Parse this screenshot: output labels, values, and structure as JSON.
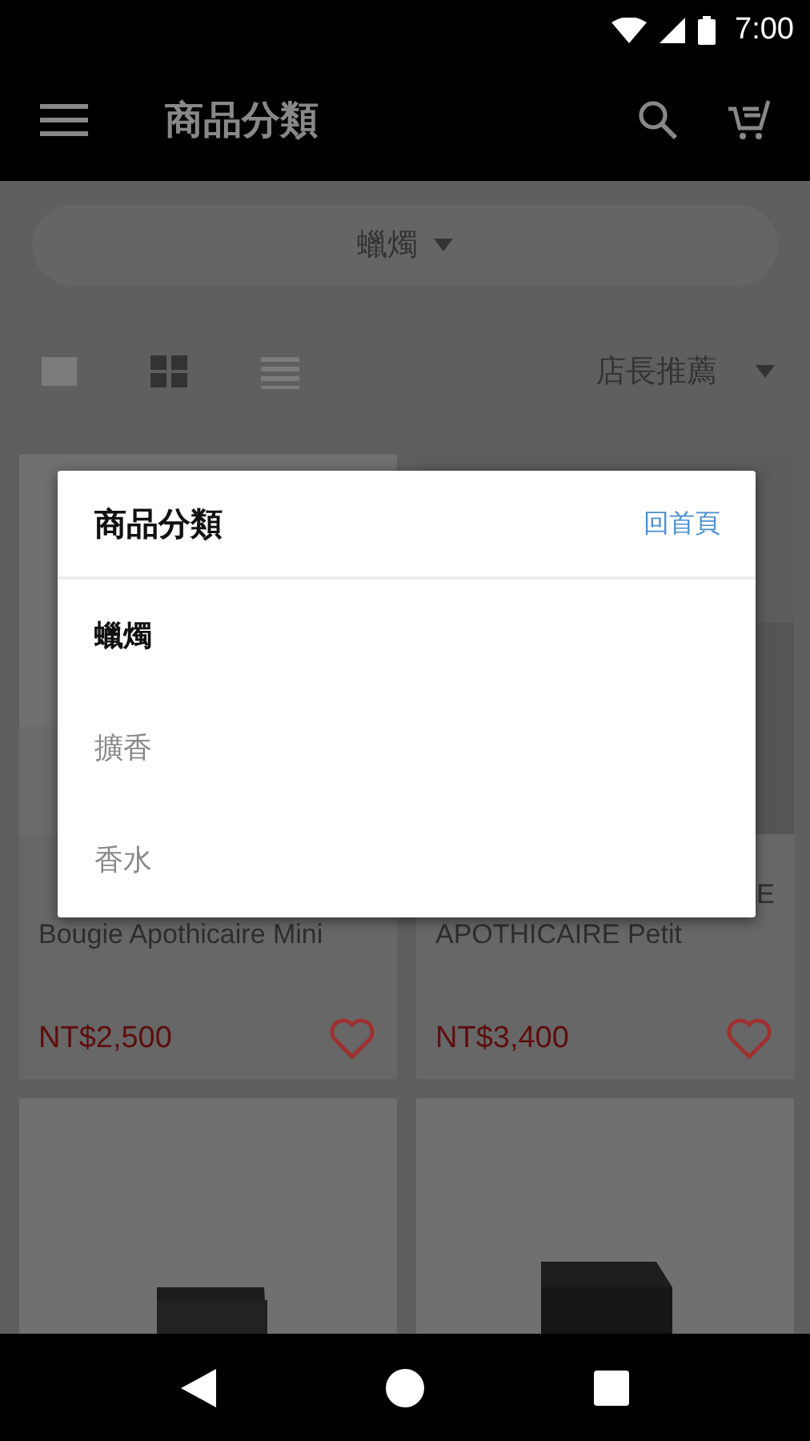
{
  "status_bar": {
    "time": "7:00"
  },
  "app_bar": {
    "title": "商品分類"
  },
  "category_filter": {
    "value": "蠟燭"
  },
  "view_modes": [
    {
      "kind": "single",
      "selected": false
    },
    {
      "kind": "grid",
      "selected": true
    },
    {
      "kind": "list",
      "selected": false
    }
  ],
  "sort": {
    "value": "店長推薦"
  },
  "products": [
    {
      "kind": "picture",
      "title": "Bougie Apothicaire Mini",
      "price": "NT$2,500",
      "favorite": false
    },
    {
      "kind": "picture",
      "title_fragment": "E",
      "title": "APOTHICAIRE Petit",
      "price": "NT$3,400",
      "favorite": false
    },
    {
      "kind": "picture"
    },
    {
      "kind": "picture"
    }
  ],
  "dialog": {
    "title": "商品分類",
    "link": "回首頁",
    "items": [
      {
        "label": "蠟燭",
        "selected": true
      },
      {
        "label": "擴香",
        "selected": false
      },
      {
        "label": "香水",
        "selected": false
      }
    ]
  }
}
